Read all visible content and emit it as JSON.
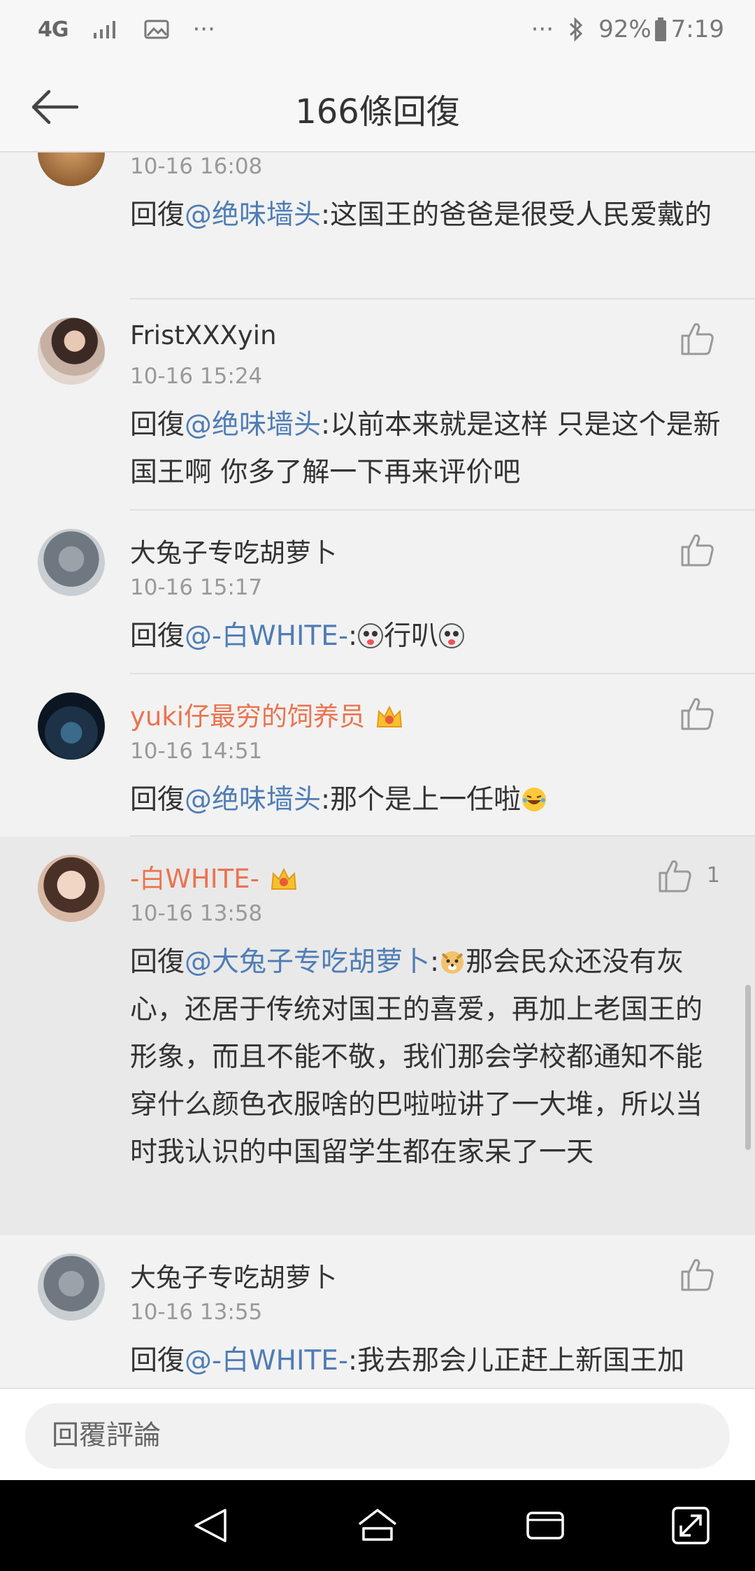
{
  "status_bar": {
    "network": "4G",
    "more": "···",
    "more_right": "···",
    "battery": "92%",
    "time": "7:19"
  },
  "header": {
    "title": "166條回復"
  },
  "comments": [
    {
      "author": "",
      "time": "10-16 16:08",
      "reply_prefix": "回復",
      "mention": "@绝味墙头",
      "text": ":这国王的爸爸是很受人民爱戴的"
    },
    {
      "author": "FristXXXyin",
      "time": "10-16 15:24",
      "reply_prefix": "回復",
      "mention": "@绝味墙头",
      "text": ":以前本来就是这样 只是这个是新国王啊 你多了解一下再来评价吧"
    },
    {
      "author": "大兔子专吃胡萝卜",
      "time": "10-16 15:17",
      "reply_prefix": "回復",
      "mention": "@-白WHITE-",
      "text_before": ":",
      "text_mid": "行叭",
      "text_after": ""
    },
    {
      "author": "yuki仔最穷的饲养员",
      "time": "10-16 14:51",
      "reply_prefix": "回復",
      "mention": "@绝味墙头",
      "text": ":那个是上一任啦"
    },
    {
      "author": "-白WHITE-",
      "time": "10-16 13:58",
      "like_count": "1",
      "reply_prefix": "回復",
      "mention": "@大兔子专吃胡萝卜",
      "text_before": ":",
      "text": "那会民众还没有灰心，还居于传统对国王的喜爱，再加上老国王的形象，而且不能不敬，我们那会学校都通知不能穿什么颜色衣服啥的巴啦啦讲了一大堆，所以当时我认识的中国留学生都在家呆了一天"
    },
    {
      "author": "大兔子专吃胡萝卜",
      "time": "10-16 13:55",
      "reply_prefix": "回復",
      "mention": "@-白WHITE-",
      "text": ":我去那会儿正赶上新国王加"
    }
  ],
  "reply_bar": {
    "placeholder": "回覆評論"
  },
  "colors": {
    "mention": "#4f7db5",
    "vip_name": "#eb7350",
    "highlight_bg": "#e9e9e9"
  },
  "icons": {
    "back": "arrow-left-icon",
    "like": "thumbs-up-icon",
    "crown": "vip-crown-icon",
    "nav_back": "nav-back-icon",
    "nav_home": "nav-home-icon",
    "nav_recents": "nav-recents-icon",
    "nav_expand": "nav-expand-icon"
  }
}
